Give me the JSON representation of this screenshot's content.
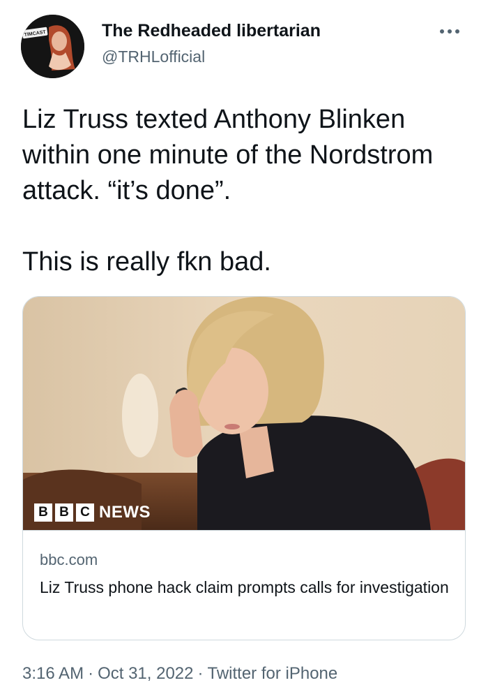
{
  "author": {
    "name": "The Redheaded libertarian",
    "handle": "@TRHLofficial",
    "avatar_badge_text": "TIMCAST"
  },
  "more_icon": "more-horizontal-icon",
  "tweet": {
    "paragraphs": [
      "Liz Truss texted Anthony Blinken within one minute of the Nordstrom attack. “it’s done”.",
      "This is really fkn bad."
    ]
  },
  "card": {
    "logo": {
      "letters": [
        "B",
        "B",
        "C"
      ],
      "word": "NEWS"
    },
    "domain": "bbc.com",
    "title": "Liz Truss phone hack claim prompts calls for investigation"
  },
  "meta": {
    "time": "3:16 AM",
    "date": "Oct 31, 2022",
    "source": "Twitter for iPhone",
    "separator": "·"
  },
  "colors": {
    "text_primary": "#0f1419",
    "text_secondary": "#536471",
    "border": "#cfd9de"
  }
}
